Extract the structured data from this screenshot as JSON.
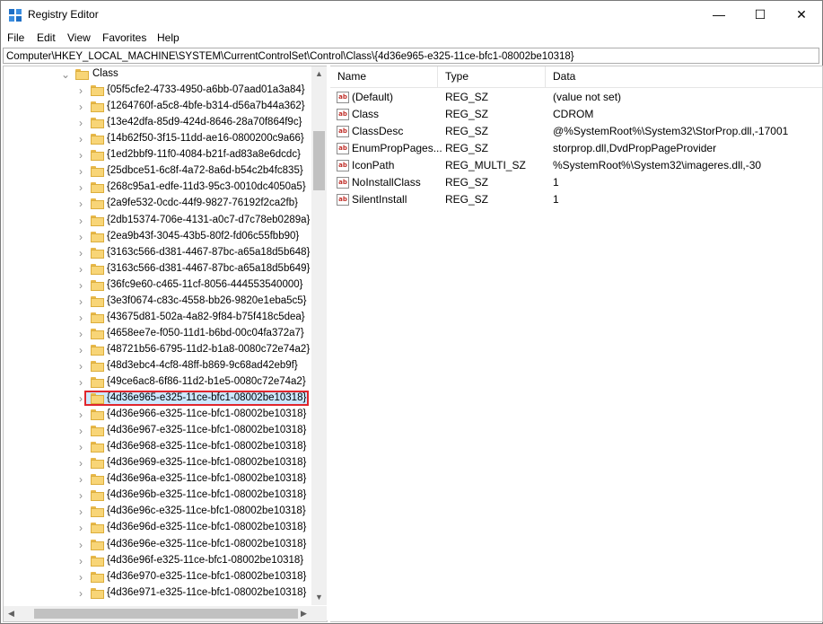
{
  "window": {
    "title": "Registry Editor",
    "minimize_glyph": "—",
    "maximize_glyph": "☐",
    "close_glyph": "✕"
  },
  "menu": [
    "File",
    "Edit",
    "View",
    "Favorites",
    "Help"
  ],
  "address": "Computer\\HKEY_LOCAL_MACHINE\\SYSTEM\\CurrentControlSet\\Control\\Class\\{4d36e965-e325-11ce-bfc1-08002be10318}",
  "tree": {
    "parent": "Class",
    "selected_index": 20,
    "keys": [
      "{05f5cfe2-4733-4950-a6bb-07aad01a3a84}",
      "{1264760f-a5c8-4bfe-b314-d56a7b44a362}",
      "{13e42dfa-85d9-424d-8646-28a70f864f9c}",
      "{14b62f50-3f15-11dd-ae16-0800200c9a66}",
      "{1ed2bbf9-11f0-4084-b21f-ad83a8e6dcdc}",
      "{25dbce51-6c8f-4a72-8a6d-b54c2b4fc835}",
      "{268c95a1-edfe-11d3-95c3-0010dc4050a5}",
      "{2a9fe532-0cdc-44f9-9827-76192f2ca2fb}",
      "{2db15374-706e-4131-a0c7-d7c78eb0289a}",
      "{2ea9b43f-3045-43b5-80f2-fd06c55fbb90}",
      "{3163c566-d381-4467-87bc-a65a18d5b648}",
      "{3163c566-d381-4467-87bc-a65a18d5b649}",
      "{36fc9e60-c465-11cf-8056-444553540000}",
      "{3e3f0674-c83c-4558-bb26-9820e1eba5c5}",
      "{43675d81-502a-4a82-9f84-b75f418c5dea}",
      "{4658ee7e-f050-11d1-b6bd-00c04fa372a7}",
      "{48721b56-6795-11d2-b1a8-0080c72e74a2}",
      "{48d3ebc4-4cf8-48ff-b869-9c68ad42eb9f}",
      "{49ce6ac8-6f86-11d2-b1e5-0080c72e74a2}",
      "{4d36e965-e325-11ce-bfc1-08002be10318}",
      "{4d36e966-e325-11ce-bfc1-08002be10318}",
      "{4d36e967-e325-11ce-bfc1-08002be10318}",
      "{4d36e968-e325-11ce-bfc1-08002be10318}",
      "{4d36e969-e325-11ce-bfc1-08002be10318}",
      "{4d36e96a-e325-11ce-bfc1-08002be10318}",
      "{4d36e96b-e325-11ce-bfc1-08002be10318}",
      "{4d36e96c-e325-11ce-bfc1-08002be10318}",
      "{4d36e96d-e325-11ce-bfc1-08002be10318}",
      "{4d36e96e-e325-11ce-bfc1-08002be10318}",
      "{4d36e96f-e325-11ce-bfc1-08002be10318}",
      "{4d36e970-e325-11ce-bfc1-08002be10318}",
      "{4d36e971-e325-11ce-bfc1-08002be10318}"
    ]
  },
  "values": {
    "headers": [
      "Name",
      "Type",
      "Data"
    ],
    "rows": [
      {
        "name": "(Default)",
        "type": "REG_SZ",
        "data": "(value not set)"
      },
      {
        "name": "Class",
        "type": "REG_SZ",
        "data": "CDROM"
      },
      {
        "name": "ClassDesc",
        "type": "REG_SZ",
        "data": "@%SystemRoot%\\System32\\StorProp.dll,-17001"
      },
      {
        "name": "EnumPropPages...",
        "type": "REG_SZ",
        "data": "storprop.dll,DvdPropPageProvider"
      },
      {
        "name": "IconPath",
        "type": "REG_MULTI_SZ",
        "data": "%SystemRoot%\\System32\\imageres.dll,-30"
      },
      {
        "name": "NoInstallClass",
        "type": "REG_SZ",
        "data": "1"
      },
      {
        "name": "SilentInstall",
        "type": "REG_SZ",
        "data": "1"
      }
    ],
    "string_icon": "ab"
  }
}
